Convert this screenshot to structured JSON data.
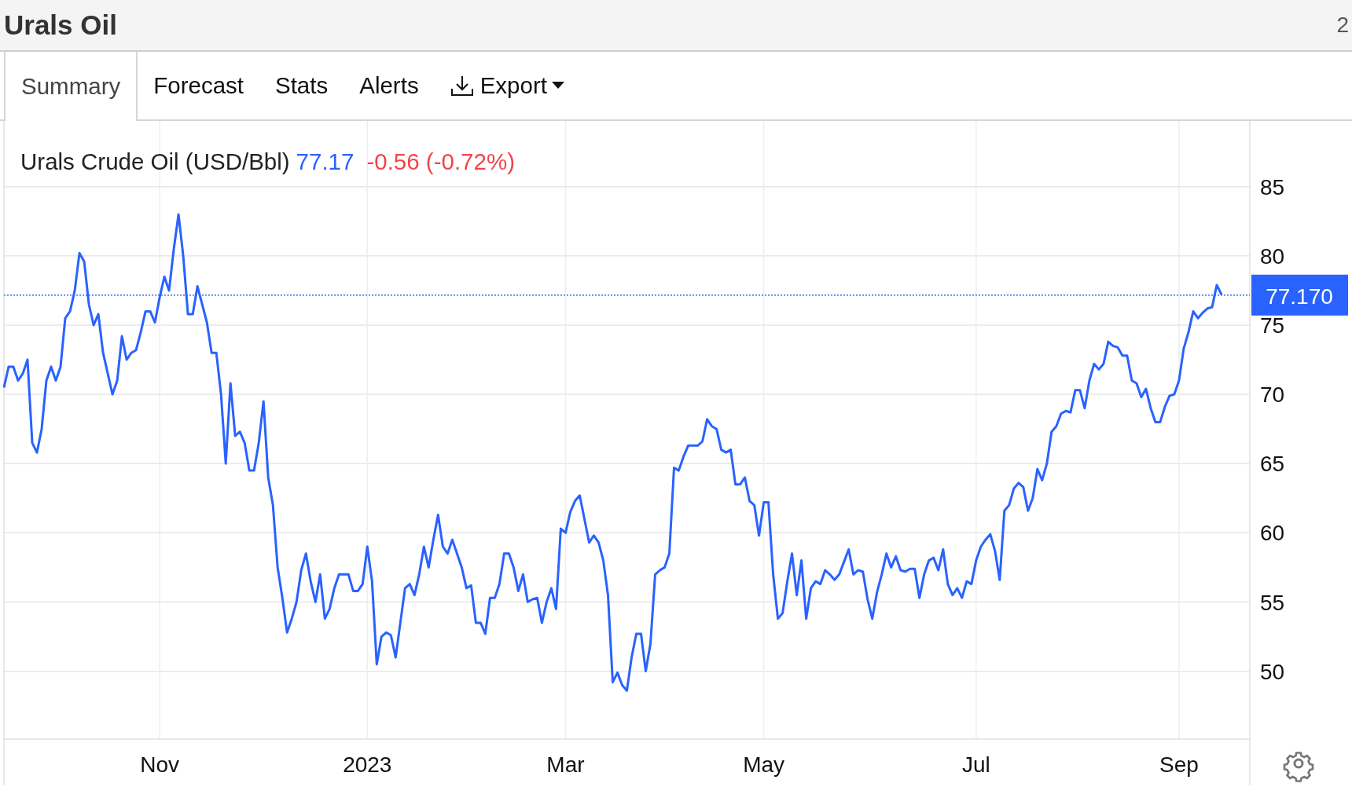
{
  "header": {
    "title": "Urals Oil",
    "corner_text": "2"
  },
  "tabs": [
    {
      "label": "Summary",
      "selected": true,
      "kind": "tab"
    },
    {
      "label": "Forecast",
      "selected": false,
      "kind": "tab"
    },
    {
      "label": "Stats",
      "selected": false,
      "kind": "tab"
    },
    {
      "label": "Alerts",
      "selected": false,
      "kind": "tab"
    },
    {
      "label": "Export",
      "selected": false,
      "kind": "menu"
    }
  ],
  "chart": {
    "legend": {
      "price": "77.17",
      "change": "-0.56 (-0.72%)"
    },
    "chart_data": {
      "type": "line",
      "grid": true,
      "ref_lines": [
        {
          "axis": "y",
          "value": 77.17,
          "label": "77.170",
          "color": "#2962ff"
        }
      ],
      "categories": [
        null,
        null,
        null,
        null,
        null,
        null,
        null,
        null,
        null,
        null,
        null,
        null,
        null,
        null,
        null,
        null,
        null,
        null,
        null,
        null,
        null,
        null,
        null,
        null,
        null,
        null,
        null,
        null,
        null,
        null,
        null,
        null,
        null,
        "Nov",
        null,
        null,
        null,
        null,
        null,
        null,
        null,
        null,
        null,
        null,
        null,
        null,
        null,
        null,
        null,
        null,
        null,
        null,
        null,
        null,
        null,
        null,
        null,
        null,
        null,
        null,
        null,
        null,
        null,
        null,
        null,
        null,
        null,
        null,
        null,
        null,
        null,
        null,
        null,
        null,
        null,
        null,
        null,
        "2023",
        null,
        null,
        null,
        null,
        null,
        null,
        null,
        null,
        null,
        null,
        null,
        null,
        null,
        null,
        null,
        null,
        null,
        null,
        null,
        null,
        null,
        null,
        null,
        null,
        null,
        null,
        null,
        null,
        null,
        null,
        null,
        null,
        null,
        null,
        null,
        null,
        null,
        null,
        null,
        null,
        null,
        "Mar",
        null,
        null,
        null,
        null,
        null,
        null,
        null,
        null,
        null,
        null,
        null,
        null,
        null,
        null,
        null,
        null,
        null,
        null,
        null,
        null,
        null,
        null,
        null,
        null,
        null,
        null,
        null,
        null,
        null,
        null,
        null,
        null,
        null,
        null,
        null,
        null,
        null,
        null,
        null,
        null,
        null,
        "May",
        null,
        null,
        null,
        null,
        null,
        null,
        null,
        null,
        null,
        null,
        null,
        null,
        null,
        null,
        null,
        null,
        null,
        null,
        null,
        null,
        null,
        null,
        null,
        null,
        null,
        null,
        null,
        null,
        null,
        null,
        null,
        null,
        null,
        null,
        null,
        null,
        null,
        null,
        null,
        null,
        null,
        null,
        null,
        null,
        "Jul",
        null,
        null,
        null,
        null,
        null,
        null,
        null,
        null,
        null,
        null,
        null,
        null,
        null,
        null,
        null,
        null,
        null,
        null,
        null,
        null,
        null,
        null,
        null,
        null,
        null,
        null,
        null,
        null,
        null,
        null,
        null,
        null,
        null,
        null,
        null,
        null,
        null,
        null,
        null,
        null,
        null,
        null,
        "Sep",
        null,
        null,
        null,
        null,
        null,
        null,
        null,
        null,
        null
      ],
      "series": [
        {
          "name": "Urals Crude Oil (USD/Bbl)",
          "color": "#2962ff",
          "values": [
            70.5,
            72,
            72,
            71,
            71.5,
            72.5,
            66.5,
            65.8,
            67.5,
            71,
            72,
            71,
            72,
            75.5,
            76,
            77.5,
            80.2,
            79.6,
            76.5,
            75,
            75.8,
            73,
            71.5,
            70,
            71,
            74.2,
            72.5,
            73,
            73.2,
            74.5,
            76,
            76,
            75.2,
            77,
            78.5,
            77.5,
            80.5,
            83,
            80,
            75.8,
            75.8,
            77.8,
            76.5,
            75.2,
            73,
            73,
            70,
            65,
            70.8,
            67,
            67.3,
            66.5,
            64.5,
            64.5,
            66.5,
            69.5,
            64,
            62,
            57.5,
            55.3,
            52.8,
            53.8,
            55,
            57.3,
            58.5,
            56.5,
            55,
            57,
            53.8,
            54.5,
            56,
            57,
            57,
            57,
            55.8,
            55.8,
            56.3,
            59,
            56.5,
            50.5,
            52.5,
            52.8,
            52.6,
            51,
            53.5,
            56,
            56.3,
            55.5,
            57,
            59,
            57.5,
            59.5,
            61.3,
            59,
            58.5,
            59.5,
            58.5,
            57.5,
            56,
            56.2,
            53.5,
            53.5,
            52.7,
            55.3,
            55.3,
            56.3,
            58.5,
            58.5,
            57.5,
            55.8,
            57,
            55,
            55.2,
            55.3,
            53.5,
            55,
            56,
            54.5,
            60.3,
            60,
            61.5,
            62.3,
            62.7,
            61,
            59.3,
            59.8,
            59.3,
            58,
            55.5,
            49.2,
            49.9,
            49,
            48.6,
            51,
            52.7,
            52.7,
            50,
            52,
            57,
            57.3,
            57.5,
            58.5,
            64.7,
            64.5,
            65.5,
            66.3,
            66.3,
            66.3,
            66.6,
            68.2,
            67.7,
            67.5,
            66,
            65.8,
            66,
            63.5,
            63.5,
            64,
            62.3,
            62,
            59.8,
            62.2,
            62.2,
            57,
            53.8,
            54.2,
            56.5,
            58.5,
            55.5,
            58,
            53.8,
            56,
            56.5,
            56.3,
            57.3,
            57,
            56.6,
            57,
            57.9,
            58.8,
            57,
            57.3,
            57.2,
            55.2,
            53.8,
            55.7,
            57,
            58.5,
            57.5,
            58.3,
            57.3,
            57.2,
            57.4,
            57.4,
            55.3,
            57,
            58,
            58.2,
            57.3,
            58.8,
            56.3,
            55.5,
            56,
            55.3,
            56.5,
            56.3,
            58,
            59,
            59.5,
            59.9,
            58.7,
            56.6,
            61.6,
            62,
            63.2,
            63.6,
            63.3,
            61.6,
            62.5,
            64.6,
            63.8,
            65,
            67.3,
            67.7,
            68.6,
            68.8,
            68.7,
            70.3,
            70.3,
            69,
            71,
            72.2,
            71.8,
            72.2,
            73.8,
            73.5,
            73.4,
            72.8,
            72.8,
            71,
            70.8,
            69.8,
            70.4,
            69,
            68,
            68,
            69.1,
            69.9,
            70,
            71,
            73.3,
            74.5,
            76,
            75.5,
            75.9,
            76.2,
            76.3,
            77.9,
            77.2
          ]
        }
      ],
      "ylim": [
        45.1,
        89.75
      ],
      "yticks": [
        50,
        55,
        60,
        65,
        70,
        75,
        80,
        85
      ]
    }
  }
}
